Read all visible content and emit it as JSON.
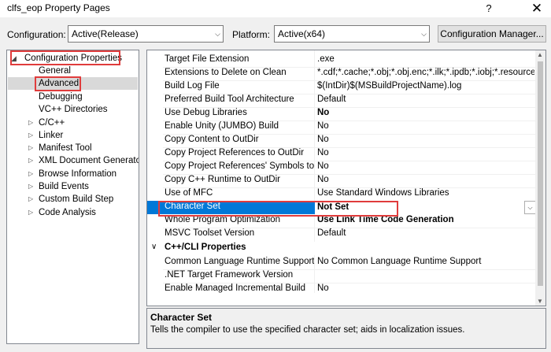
{
  "window": {
    "title": "clfs_eop Property Pages",
    "help_glyph": "?",
    "close_glyph": "✕"
  },
  "toolbar": {
    "configuration_label": "Configuration:",
    "configuration_value": "Active(Release)",
    "platform_label": "Platform:",
    "platform_value": "Active(x64)",
    "config_manager_label": "Configuration Manager..."
  },
  "tree": {
    "root_label": "Configuration Properties",
    "items": [
      {
        "label": "General"
      },
      {
        "label": "Advanced"
      },
      {
        "label": "Debugging"
      },
      {
        "label": "VC++ Directories"
      },
      {
        "label": "C/C++"
      },
      {
        "label": "Linker"
      },
      {
        "label": "Manifest Tool"
      },
      {
        "label": "XML Document Generator"
      },
      {
        "label": "Browse Information"
      },
      {
        "label": "Build Events"
      },
      {
        "label": "Custom Build Step"
      },
      {
        "label": "Code Analysis"
      }
    ]
  },
  "grid": {
    "rows": [
      {
        "name": "Target File Extension",
        "value": ".exe"
      },
      {
        "name": "Extensions to Delete on Clean",
        "value": "*.cdf;*.cache;*.obj;*.obj.enc;*.ilk;*.ipdb;*.iobj;*.resources;*.t"
      },
      {
        "name": "Build Log File",
        "value": "$(IntDir)$(MSBuildProjectName).log"
      },
      {
        "name": "Preferred Build Tool Architecture",
        "value": "Default"
      },
      {
        "name": "Use Debug Libraries",
        "value": "No"
      },
      {
        "name": "Enable Unity (JUMBO) Build",
        "value": "No"
      },
      {
        "name": "Copy Content to OutDir",
        "value": "No"
      },
      {
        "name": "Copy Project References to OutDir",
        "value": "No"
      },
      {
        "name": "Copy Project References' Symbols to OutDir",
        "value": "No"
      },
      {
        "name": "Copy C++ Runtime to OutDir",
        "value": "No"
      },
      {
        "name": "Use of MFC",
        "value": "Use Standard Windows Libraries"
      },
      {
        "name": "Character Set",
        "value": "Not Set"
      },
      {
        "name": "Whole Program Optimization",
        "value": "Use Link Time Code Generation"
      },
      {
        "name": "MSVC Toolset Version",
        "value": "Default"
      }
    ],
    "category": {
      "name": "C++/CLI Properties"
    },
    "cli_rows": [
      {
        "name": "Common Language Runtime Support",
        "value": "No Common Language Runtime Support"
      },
      {
        "name": ".NET Target Framework Version",
        "value": ""
      },
      {
        "name": "Enable Managed Incremental Build",
        "value": "No"
      }
    ]
  },
  "description": {
    "title": "Character Set",
    "text": "Tells the compiler to use the specified character set; aids in localization issues."
  },
  "colors": {
    "selection": "#0078d7",
    "highlight_box": "#e03c3c"
  }
}
